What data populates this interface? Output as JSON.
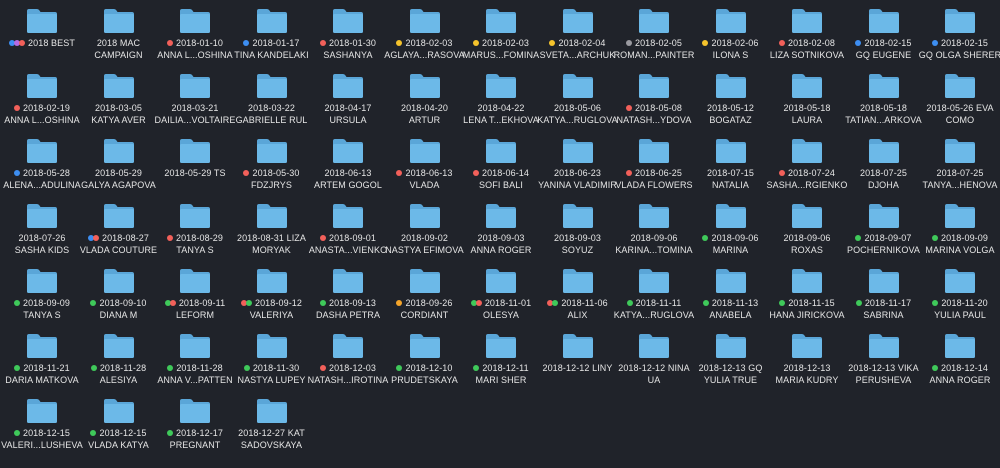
{
  "view": "finder-icon-view",
  "colors": {
    "background": "#20232a",
    "folder_front": "#6cb9e8",
    "folder_back": "#5aa6d8",
    "label_text": "#e6e6e6"
  },
  "tag_colors": {
    "red": "#f2605a",
    "yellow": "#f5c32c",
    "blue": "#3d8ef2",
    "purple": "#b36ae2",
    "gray": "#9a9aa0",
    "green": "#3fc95a",
    "orange": "#f5a52a"
  },
  "folder_icon": "folder-icon",
  "folders": [
    {
      "lines": [
        "2018 BEST"
      ],
      "tags": [
        "blue",
        "purple",
        "red"
      ]
    },
    {
      "lines": [
        "2018 MAC",
        "CAMPAIGN"
      ],
      "tags": []
    },
    {
      "lines": [
        "2018-01-10",
        "ANNA L...OSHINA"
      ],
      "tags": [
        "red"
      ]
    },
    {
      "lines": [
        "2018-01-17",
        "TINA KANDELAKI"
      ],
      "tags": [
        "blue"
      ]
    },
    {
      "lines": [
        "2018-01-30",
        "SASHANYA"
      ],
      "tags": [
        "red"
      ]
    },
    {
      "lines": [
        "2018-02-03",
        "AGLAYA...RASOVA"
      ],
      "tags": [
        "yellow"
      ]
    },
    {
      "lines": [
        "2018-02-03",
        "MARUS...FOMINA"
      ],
      "tags": [
        "yellow"
      ]
    },
    {
      "lines": [
        "2018-02-04",
        "SVETA...ARCHUK"
      ],
      "tags": [
        "yellow"
      ]
    },
    {
      "lines": [
        "2018-02-05",
        "ROMAN...PAINTER"
      ],
      "tags": [
        "gray"
      ]
    },
    {
      "lines": [
        "2018-02-06",
        "ILONA S"
      ],
      "tags": [
        "yellow"
      ]
    },
    {
      "lines": [
        "2018-02-08",
        "LIZA SOTNIKOVA"
      ],
      "tags": [
        "red"
      ]
    },
    {
      "lines": [
        "2018-02-15",
        "GQ EUGENE"
      ],
      "tags": [
        "blue"
      ]
    },
    {
      "lines": [
        "2018-02-15",
        "GQ OLGA SHERER"
      ],
      "tags": [
        "blue"
      ]
    },
    {
      "lines": [
        "2018-02-19",
        "ANNA L...OSHINA"
      ],
      "tags": [
        "red"
      ]
    },
    {
      "lines": [
        "2018-03-05",
        "KATYA AVER"
      ],
      "tags": []
    },
    {
      "lines": [
        "2018-03-21",
        "DAILIA...VOLTAIRE"
      ],
      "tags": []
    },
    {
      "lines": [
        "2018-03-22",
        "GABRIELLE RUL"
      ],
      "tags": []
    },
    {
      "lines": [
        "2018-04-17",
        "URSULA"
      ],
      "tags": []
    },
    {
      "lines": [
        "2018-04-20",
        "ARTUR"
      ],
      "tags": []
    },
    {
      "lines": [
        "2018-04-22",
        "LENA T...EKHOVA"
      ],
      "tags": []
    },
    {
      "lines": [
        "2018-05-06",
        "KATYA...RUGLOVA"
      ],
      "tags": []
    },
    {
      "lines": [
        "2018-05-08",
        "NATASH...YDOVA"
      ],
      "tags": [
        "red"
      ]
    },
    {
      "lines": [
        "2018-05-12",
        "BOGATAZ"
      ],
      "tags": []
    },
    {
      "lines": [
        "2018-05-18",
        "LAURA"
      ],
      "tags": []
    },
    {
      "lines": [
        "2018-05-18",
        "TATIAN...ARKOVA"
      ],
      "tags": []
    },
    {
      "lines": [
        "2018-05-26 EVA",
        "COMO"
      ],
      "tags": []
    },
    {
      "lines": [
        "2018-05-28",
        "ALENA...ADULINA"
      ],
      "tags": [
        "blue"
      ]
    },
    {
      "lines": [
        "2018-05-29",
        "GALYA AGAPOVA"
      ],
      "tags": []
    },
    {
      "lines": [
        "2018-05-29 TS"
      ],
      "tags": []
    },
    {
      "lines": [
        "2018-05-30",
        "FDZJRYS"
      ],
      "tags": [
        "red"
      ]
    },
    {
      "lines": [
        "2018-06-13",
        "ARTEM GOGOL"
      ],
      "tags": []
    },
    {
      "lines": [
        "2018-06-13",
        "VLADA"
      ],
      "tags": [
        "red"
      ]
    },
    {
      "lines": [
        "2018-06-14",
        "SOFI BALI"
      ],
      "tags": [
        "red"
      ]
    },
    {
      "lines": [
        "2018-06-23",
        "YANINA VLADIMIR"
      ],
      "tags": []
    },
    {
      "lines": [
        "2018-06-25",
        "VLADA FLOWERS"
      ],
      "tags": [
        "red"
      ]
    },
    {
      "lines": [
        "2018-07-15",
        "NATALIA"
      ],
      "tags": []
    },
    {
      "lines": [
        "2018-07-24",
        "SASHA...RGIENKO"
      ],
      "tags": [
        "red"
      ]
    },
    {
      "lines": [
        "2018-07-25",
        "DJOHA"
      ],
      "tags": []
    },
    {
      "lines": [
        "2018-07-25",
        "TANYA...HENOVA"
      ],
      "tags": []
    },
    {
      "lines": [
        "2018-07-26",
        "SASHA KIDS"
      ],
      "tags": []
    },
    {
      "lines": [
        "2018-08-27",
        "VLADA COUTURE"
      ],
      "tags": [
        "blue",
        "red"
      ]
    },
    {
      "lines": [
        "2018-08-29",
        "TANYA S"
      ],
      "tags": [
        "red"
      ]
    },
    {
      "lines": [
        "2018-08-31 LIZA",
        "MORYAK"
      ],
      "tags": []
    },
    {
      "lines": [
        "2018-09-01",
        "ANASTA...VIENKO"
      ],
      "tags": [
        "red"
      ]
    },
    {
      "lines": [
        "2018-09-02",
        "NASTYA EFIMOVA"
      ],
      "tags": []
    },
    {
      "lines": [
        "2018-09-03",
        "ANNA ROGER"
      ],
      "tags": []
    },
    {
      "lines": [
        "2018-09-03",
        "SOYUZ"
      ],
      "tags": []
    },
    {
      "lines": [
        "2018-09-06",
        "KARINA...TOMINA"
      ],
      "tags": []
    },
    {
      "lines": [
        "2018-09-06",
        "MARINA"
      ],
      "tags": [
        "green"
      ]
    },
    {
      "lines": [
        "2018-09-06",
        "ROXAS"
      ],
      "tags": []
    },
    {
      "lines": [
        "2018-09-07",
        "POCHERNIKOVA"
      ],
      "tags": [
        "green"
      ]
    },
    {
      "lines": [
        "2018-09-09",
        "MARINA VOLGA"
      ],
      "tags": [
        "green"
      ]
    },
    {
      "lines": [
        "2018-09-09",
        "TANYA S"
      ],
      "tags": [
        "green"
      ]
    },
    {
      "lines": [
        "2018-09-10",
        "DIANA M"
      ],
      "tags": [
        "green"
      ]
    },
    {
      "lines": [
        "2018-09-11",
        "LEFORM"
      ],
      "tags": [
        "green",
        "red"
      ]
    },
    {
      "lines": [
        "2018-09-12",
        "VALERIYA"
      ],
      "tags": [
        "red",
        "green"
      ]
    },
    {
      "lines": [
        "2018-09-13",
        "DASHA PETRA"
      ],
      "tags": [
        "green"
      ]
    },
    {
      "lines": [
        "2018-09-26",
        "CORDIANT"
      ],
      "tags": [
        "orange"
      ]
    },
    {
      "lines": [
        "2018-11-01",
        "OLESYA"
      ],
      "tags": [
        "green",
        "red"
      ]
    },
    {
      "lines": [
        "2018-11-06",
        "ALIX"
      ],
      "tags": [
        "red",
        "green"
      ]
    },
    {
      "lines": [
        "2018-11-11",
        "KATYA...RUGLOVA"
      ],
      "tags": [
        "green"
      ]
    },
    {
      "lines": [
        "2018-11-13",
        "ANABELA"
      ],
      "tags": [
        "green"
      ]
    },
    {
      "lines": [
        "2018-11-15",
        "HANA JIRICKOVA"
      ],
      "tags": [
        "green"
      ]
    },
    {
      "lines": [
        "2018-11-17",
        "SABRINA"
      ],
      "tags": [
        "green"
      ]
    },
    {
      "lines": [
        "2018-11-20",
        "YULIA PAUL"
      ],
      "tags": [
        "green"
      ]
    },
    {
      "lines": [
        "2018-11-21",
        "DARIA MATKOVA"
      ],
      "tags": [
        "green"
      ]
    },
    {
      "lines": [
        "2018-11-28",
        "ALESIYA"
      ],
      "tags": [
        "green"
      ]
    },
    {
      "lines": [
        "2018-11-28",
        "ANNA V...PATTEN"
      ],
      "tags": [
        "green"
      ]
    },
    {
      "lines": [
        "2018-11-30",
        "NASTYA LUPEY"
      ],
      "tags": [
        "green"
      ]
    },
    {
      "lines": [
        "2018-12-03",
        "NATASH...IROTINA"
      ],
      "tags": [
        "red"
      ]
    },
    {
      "lines": [
        "2018-12-10",
        "PRUDETSKAYA"
      ],
      "tags": [
        "green"
      ]
    },
    {
      "lines": [
        "2018-12-11",
        "MARI SHER"
      ],
      "tags": [
        "green"
      ]
    },
    {
      "lines": [
        "2018-12-12 LINY"
      ],
      "tags": []
    },
    {
      "lines": [
        "2018-12-12 NINA",
        "UA"
      ],
      "tags": []
    },
    {
      "lines": [
        "2018-12-13 GQ",
        "YULIA TRUE"
      ],
      "tags": []
    },
    {
      "lines": [
        "2018-12-13",
        "MARIA KUDRY"
      ],
      "tags": []
    },
    {
      "lines": [
        "2018-12-13 VIKA",
        "PERUSHEVA"
      ],
      "tags": []
    },
    {
      "lines": [
        "2018-12-14",
        "ANNA ROGER"
      ],
      "tags": [
        "green"
      ]
    },
    {
      "lines": [
        "2018-12-15",
        "VALERI...LUSHEVA"
      ],
      "tags": [
        "green"
      ]
    },
    {
      "lines": [
        "2018-12-15",
        "VLADA KATYA"
      ],
      "tags": [
        "green"
      ]
    },
    {
      "lines": [
        "2018-12-17",
        "PREGNANT"
      ],
      "tags": [
        "green"
      ]
    },
    {
      "lines": [
        "2018-12-27 KAT",
        "SADOVSKAYA"
      ],
      "tags": []
    }
  ]
}
